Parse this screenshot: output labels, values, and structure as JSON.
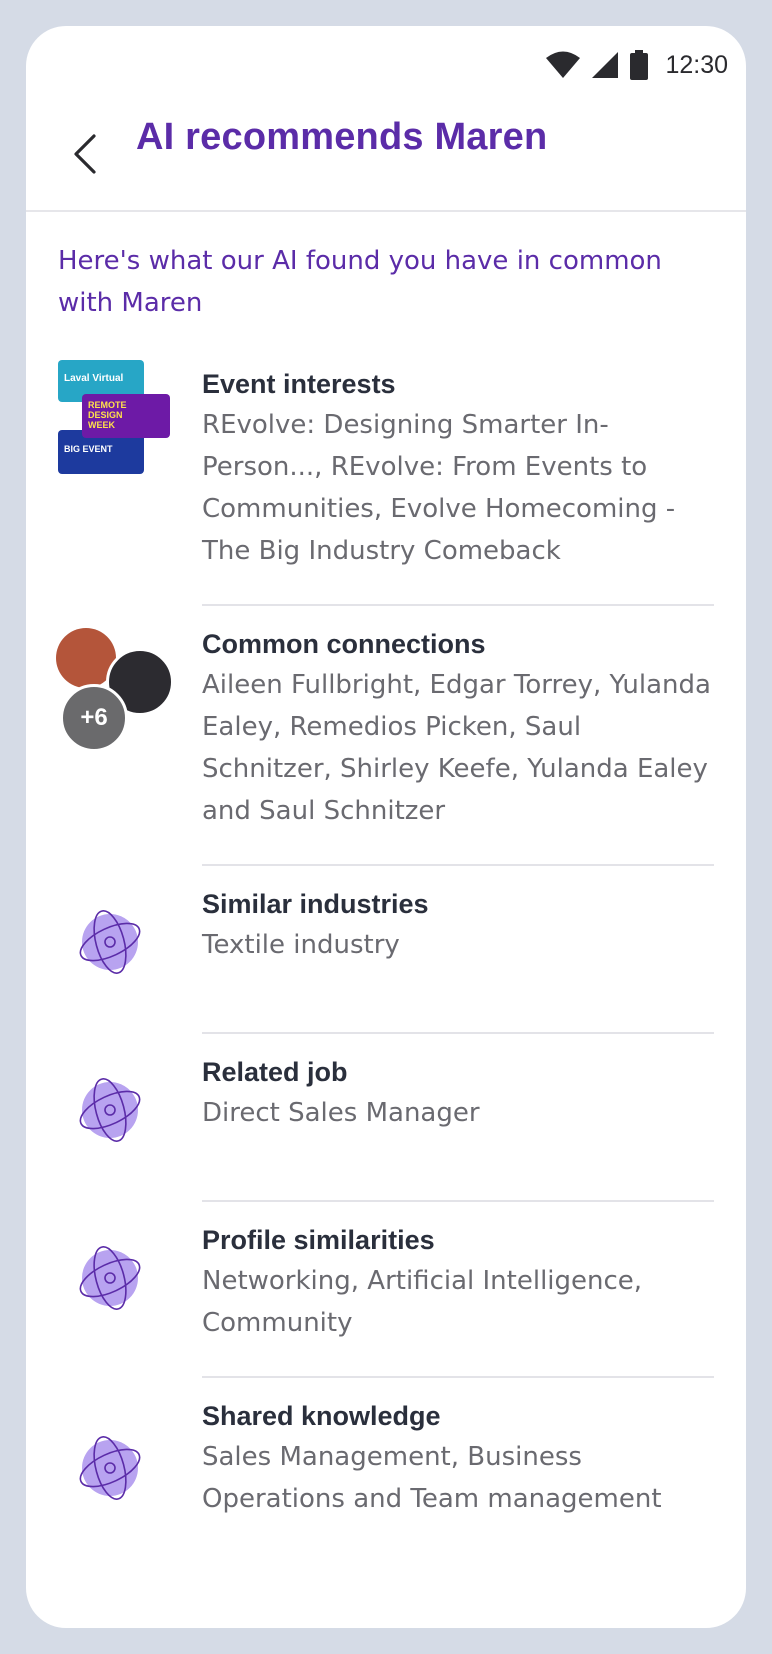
{
  "status": {
    "time": "12:30"
  },
  "header": {
    "title": "AI recommends Maren",
    "back_icon": "chevron-left-icon"
  },
  "intro": "Here's what our AI found you have in common with Maren",
  "events_thumb": [
    "Laval Virtual",
    "REMOTE DESIGN WEEK",
    "BIG EVENT"
  ],
  "connections_more": "+6",
  "items": [
    {
      "title": "Event interests",
      "text": "REvolve: Designing Smarter In-Person..., REvolve: From Events to Communities, Evolve Homecoming - The Big Industry Comeback",
      "icon": "event-thumbnails"
    },
    {
      "title": "Common connections",
      "text": "Aileen Fullbright, Edgar Torrey, Yulanda Ealey, Remedios Picken, Saul Schnitzer, Shirley Keefe, Yulanda Ealey and Saul Schnitzer",
      "icon": "avatars"
    },
    {
      "title": "Similar industries",
      "text": "Textile industry",
      "icon": "ai-atom-icon"
    },
    {
      "title": "Related job",
      "text": "Direct Sales Manager",
      "icon": "ai-atom-icon"
    },
    {
      "title": "Profile similarities",
      "text": "Networking, Artificial Intelligence, Community",
      "icon": "ai-atom-icon"
    },
    {
      "title": "Shared knowledge",
      "text": "Sales Management, Business Operations and Team management",
      "icon": "ai-atom-icon"
    }
  ],
  "colors": {
    "accent": "#5b2ca8",
    "title_text": "#2a2f3c",
    "body_text": "#6a6a70",
    "icon_fill": "#b8a3f0"
  }
}
